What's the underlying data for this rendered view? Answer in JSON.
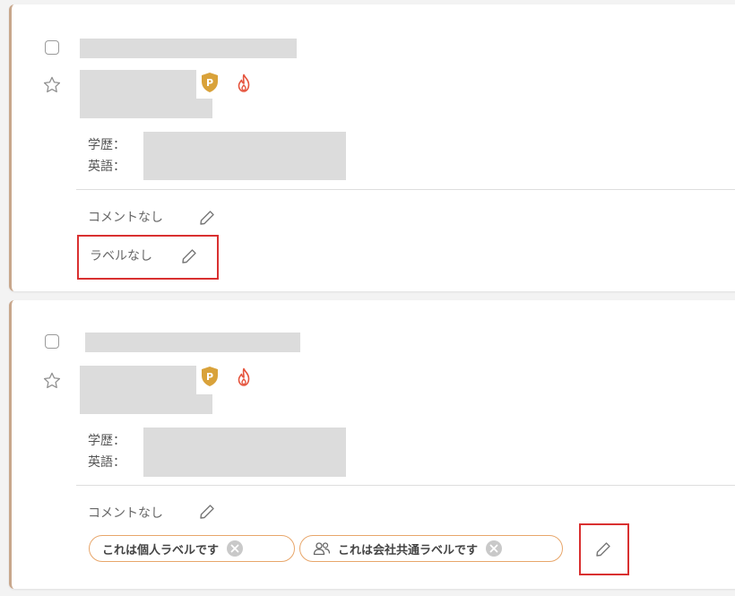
{
  "candidates": [
    {
      "education_label": "学歴：",
      "english_label": "英語：",
      "comment_text": "コメントなし",
      "label_text": "ラベルなし"
    },
    {
      "education_label": "学歴：",
      "english_label": "英語：",
      "comment_text": "コメントなし",
      "labels": [
        {
          "text": "これは個人ラベルです",
          "icon": "none"
        },
        {
          "text": "これは会社共通ラベルです",
          "icon": "people-icon"
        }
      ]
    }
  ],
  "colors": {
    "card_accent": "#c8a78c",
    "chip_border": "#e8a66a",
    "badge_gold": "#d9a23a",
    "fire_red": "#e5533c",
    "highlight_red": "#d93030"
  }
}
